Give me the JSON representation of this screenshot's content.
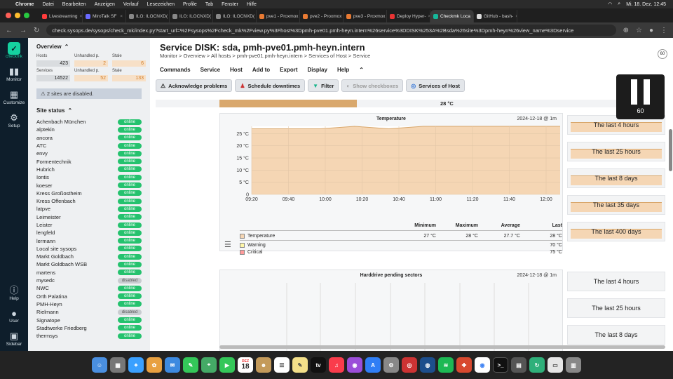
{
  "menubar": {
    "app": "Chrome",
    "items": [
      "Datei",
      "Bearbeiten",
      "Anzeigen",
      "Verlauf",
      "Lesezeichen",
      "Profile",
      "Tab",
      "Fenster",
      "Hilfe"
    ],
    "clock": "Mi. 18. Dez. 12:45"
  },
  "tabs": [
    {
      "label": "Livestreaming",
      "color": "#ff3c3c"
    },
    {
      "label": "MiroTalk SF",
      "color": "#6a6aff"
    },
    {
      "label": "ILO: ILOCNXD(",
      "color": "#888888"
    },
    {
      "label": "ILO: ILOCNXD(",
      "color": "#888888"
    },
    {
      "label": "ILO: ILOCNXD(",
      "color": "#888888"
    },
    {
      "label": "pve1 - Proxmox",
      "color": "#e87a33"
    },
    {
      "label": "pve2 - Proxmox",
      "color": "#e87a33"
    },
    {
      "label": "pve3 - Proxmox",
      "color": "#e87a33"
    },
    {
      "label": "Deploy Hyper-",
      "color": "#e83333"
    },
    {
      "label": "Checkmk Loca",
      "color": "#16b79a",
      "active": true
    },
    {
      "label": "GitHub - bash-",
      "color": "#dddddd"
    }
  ],
  "url": "check.sysops.de/sysops/check_mk/index.py?start_url=%2Fsysops%2Fcheck_mk%2Fview.py%3Fhost%3Dpmh-pve01.pmh-heyn.intern%26service%3DDISK%253A%2Bsda%26site%3Dpmh-heyn%26view_name%3Dservice",
  "sidebar": {
    "logo": "checkmk",
    "nav": [
      {
        "label": "Monitor",
        "icon": "bar-chart-icon"
      },
      {
        "label": "Customize",
        "icon": "grid-icon"
      },
      {
        "label": "Setup",
        "icon": "gear-icon"
      },
      {
        "label": "Help",
        "icon": "info-icon"
      },
      {
        "label": "User",
        "icon": "user-icon"
      },
      {
        "label": "Sidebar",
        "icon": "sidebar-icon"
      }
    ]
  },
  "overview": {
    "title": "Overview",
    "hosts_label": "Hosts",
    "hosts": "423",
    "unhandled_label": "Unhandled p.",
    "hosts_unhandled": "2",
    "stale_label": "Stale",
    "hosts_stale": "6",
    "services_label": "Services",
    "services": "14522",
    "services_unhandled": "52",
    "services_stale": "133",
    "notice": "2 sites are disabled."
  },
  "site_status": {
    "title": "Site status",
    "sites": [
      {
        "name": "Achenbach München",
        "state": "online"
      },
      {
        "name": "alptekin",
        "state": "online"
      },
      {
        "name": "ancora",
        "state": "online"
      },
      {
        "name": "ATC",
        "state": "online"
      },
      {
        "name": "envy",
        "state": "online"
      },
      {
        "name": "Formentechnik",
        "state": "online"
      },
      {
        "name": "Hubrich",
        "state": "online"
      },
      {
        "name": "Iontis",
        "state": "online"
      },
      {
        "name": "koeser",
        "state": "online"
      },
      {
        "name": "Kress Großostheim",
        "state": "online"
      },
      {
        "name": "Kress Offenbach",
        "state": "online"
      },
      {
        "name": "latpve",
        "state": "online"
      },
      {
        "name": "Leimeister",
        "state": "online"
      },
      {
        "name": "Leister",
        "state": "online"
      },
      {
        "name": "lengfeld",
        "state": "online"
      },
      {
        "name": "lermann",
        "state": "online"
      },
      {
        "name": "Local site sysops",
        "state": "online"
      },
      {
        "name": "Markt Goldbach",
        "state": "online"
      },
      {
        "name": "Markt Goldbach WSB",
        "state": "online"
      },
      {
        "name": "martens",
        "state": "online"
      },
      {
        "name": "mysedc",
        "state": "disabled"
      },
      {
        "name": "NWC",
        "state": "online"
      },
      {
        "name": "Orth Palatina",
        "state": "online"
      },
      {
        "name": "PMH-Heyn",
        "state": "online"
      },
      {
        "name": "Rielmann",
        "state": "disabled"
      },
      {
        "name": "Signatope",
        "state": "online"
      },
      {
        "name": "Stadtwerke Friedberg",
        "state": "online"
      },
      {
        "name": "thermsys",
        "state": "online"
      }
    ]
  },
  "page": {
    "title": "Service DISK: sda, pmh-pve01.pmh-heyn.intern",
    "breadcrumb": "Monitor > Overview > All hosts > pmh-pve01.pmh-heyn.intern > Services of Host > Service",
    "refresh": "60",
    "menu": [
      "Commands",
      "Service",
      "Host",
      "Add to",
      "Export",
      "Display",
      "Help"
    ],
    "buttons": {
      "ack": "Acknowledge problems",
      "downtime": "Schedule downtimes",
      "filter": "Filter",
      "checkboxes": "Show checkboxes",
      "services": "Services of Host"
    },
    "temp_value": "28 °C"
  },
  "pause_overlay": {
    "count": "60"
  },
  "chart_data": [
    {
      "type": "area",
      "title": "Temperature",
      "date": "2024-12-18 @ 1m",
      "x": [
        "09:20",
        "09:40",
        "10:00",
        "10:20",
        "10:40",
        "11:00",
        "11:20",
        "11:40",
        "12:00"
      ],
      "yticks": [
        "0",
        "5 °C",
        "10 °C",
        "15 °C",
        "20 °C",
        "25 °C"
      ],
      "ylim": [
        0,
        28
      ],
      "series": [
        {
          "name": "Temperature",
          "values": [
            27,
            27,
            27,
            28,
            27,
            28,
            28,
            28,
            28,
            28
          ]
        }
      ],
      "legend_header": [
        "Minimum",
        "Maximum",
        "Average",
        "Last"
      ],
      "legend": [
        {
          "name": "Temperature",
          "color": "#f5d6b4",
          "min": "27 °C",
          "max": "28 °C",
          "avg": "27.7 °C",
          "last": "28 °C"
        },
        {
          "name": "Warning",
          "color": "#fff7a8",
          "last": "70 °C"
        },
        {
          "name": "Critical",
          "color": "#ff9b9b",
          "last": "75 °C"
        }
      ]
    },
    {
      "type": "area",
      "title": "Harddrive pending sectors",
      "date": "2024-12-18 @ 1m"
    }
  ],
  "mini_graphs": {
    "temperature": [
      "The last 4 hours",
      "The last 25 hours",
      "The last 8 days",
      "The last 35 days",
      "The last 400 days"
    ],
    "pending": [
      "The last 4 hours",
      "The last 25 hours",
      "The last 8 days"
    ]
  },
  "dock": {
    "calendar_month": "DEZ",
    "calendar_day": "18"
  }
}
